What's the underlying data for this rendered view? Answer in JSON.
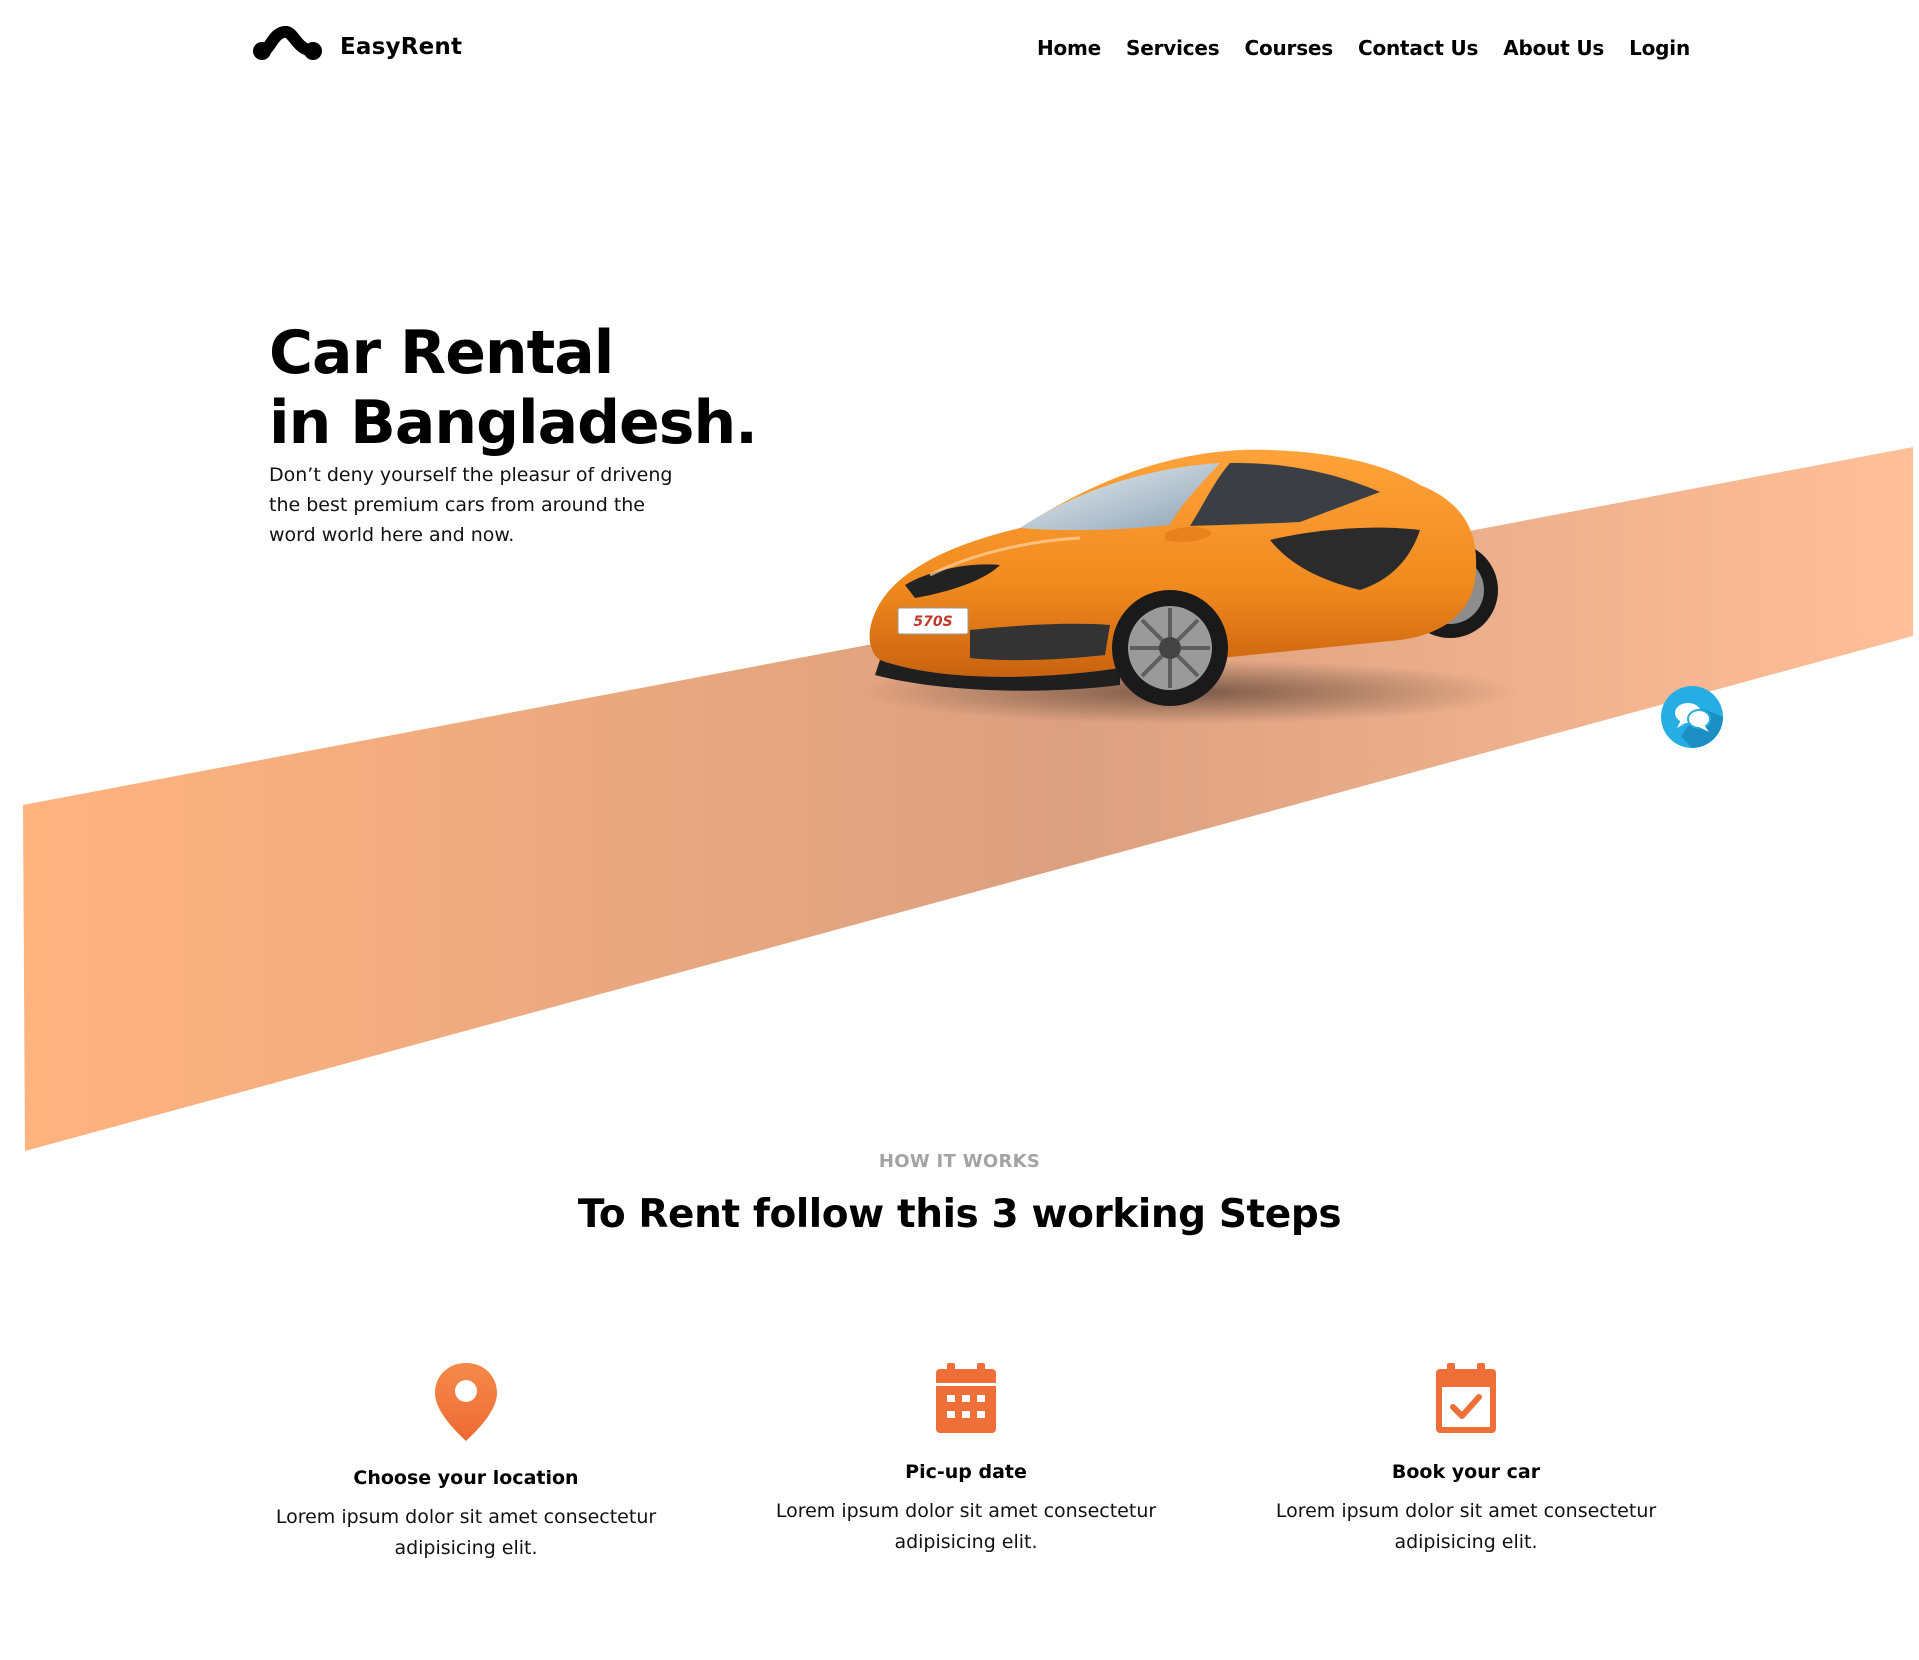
{
  "brand": {
    "name": "EasyRent",
    "logo_icon": "logo-mark-icon"
  },
  "nav": {
    "items": [
      {
        "label": "Home"
      },
      {
        "label": "Services"
      },
      {
        "label": "Courses"
      },
      {
        "label": "Contact Us"
      },
      {
        "label": "About Us"
      },
      {
        "label": "Login"
      }
    ]
  },
  "hero": {
    "title_line1": "Car Rental",
    "title_line2": "in Bangladesh.",
    "subtitle": "Don’t deny yourself the pleasur of driveng the best premium cars from around the word world here and now.",
    "car_plate": "570S",
    "chat_icon": "chat-bubbles-icon"
  },
  "how_it_works": {
    "label": "HOW IT WORKS",
    "title": "To Rent follow this 3 working Steps",
    "steps": [
      {
        "icon": "location-pin-icon",
        "title": "Choose your location",
        "text": "Lorem ipsum dolor sit amet consectetur adipisicing elit."
      },
      {
        "icon": "calendar-icon",
        "title": "Pic-up date",
        "text": "Lorem ipsum dolor sit amet consectetur adipisicing elit."
      },
      {
        "icon": "calendar-check-icon",
        "title": "Book your car",
        "text": "Lorem ipsum dolor sit amet consectetur adipisicing elit."
      }
    ]
  },
  "colors": {
    "accent_orange": "#f07838",
    "road_light": "#ffb37f",
    "road_dark": "#dba080",
    "chat_blue": "#26aee4",
    "muted_label": "#a3a3a3"
  }
}
